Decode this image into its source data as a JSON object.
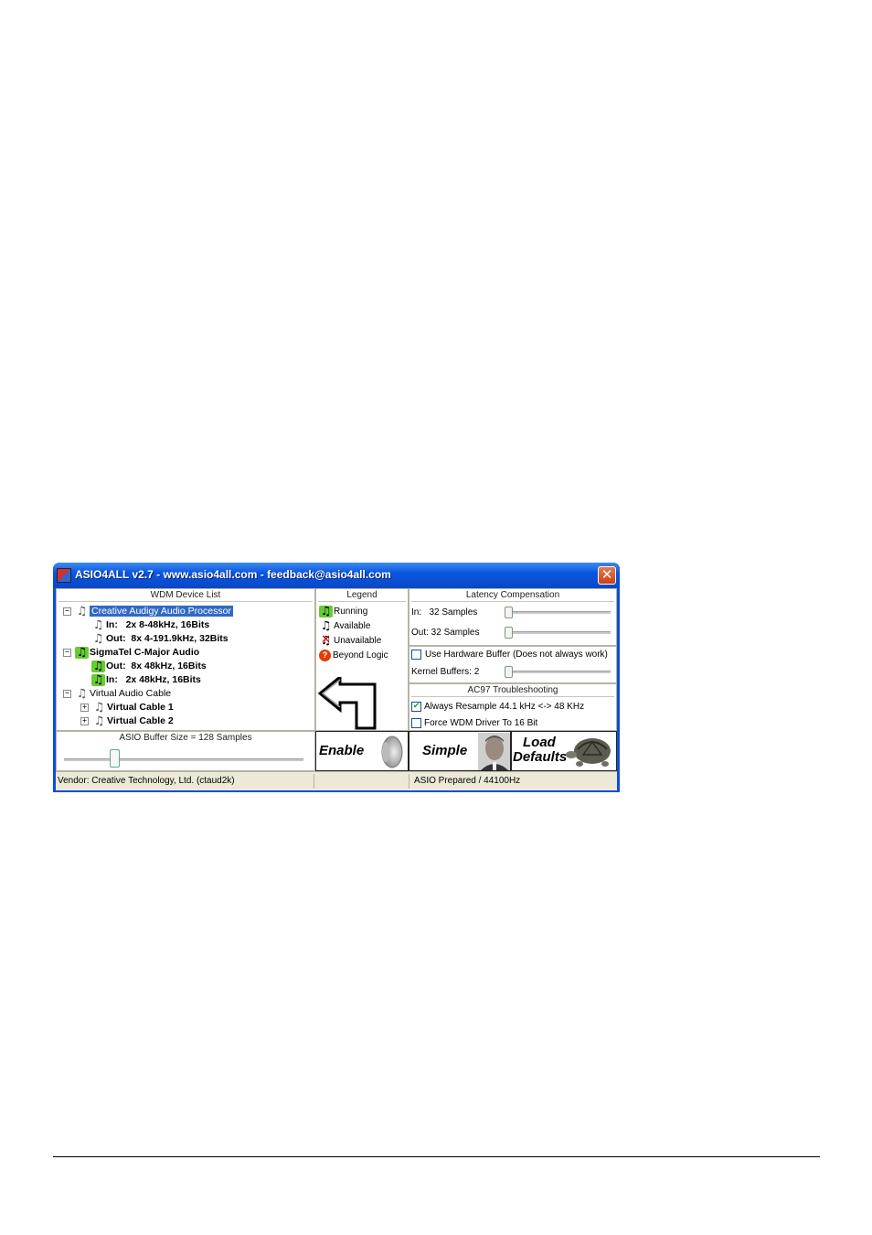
{
  "window": {
    "title": "ASIO4ALL v2.7 - www.asio4all.com - feedback@asio4all.com",
    "close_glyph": "✕"
  },
  "device_list": {
    "title": "WDM Device List",
    "items": [
      {
        "label": "Creative Audigy Audio Processor",
        "expander": "−",
        "icon": "note-available",
        "selected": true
      },
      {
        "label": "In:   2x 8-48kHz, 16Bits",
        "icon": "note-available"
      },
      {
        "label": "Out:  8x 4-191.9kHz, 32Bits",
        "icon": "note-available"
      },
      {
        "label": "SigmaTel C-Major Audio",
        "expander": "−",
        "icon": "note-running"
      },
      {
        "label": "Out:  8x 48kHz, 16Bits",
        "icon": "note-running"
      },
      {
        "label": "In:   2x 48kHz, 16Bits",
        "icon": "note-running"
      },
      {
        "label": "Virtual Audio Cable",
        "expander": "−",
        "icon": "note-available"
      },
      {
        "label": "Virtual Cable 1",
        "expander": "+",
        "icon": "note-available"
      },
      {
        "label": "Virtual Cable 2",
        "expander": "+",
        "icon": "note-available"
      }
    ]
  },
  "legend": {
    "title": "Legend",
    "items": [
      {
        "label": "Running",
        "icon": "note-running"
      },
      {
        "label": "Available",
        "icon": "note-available"
      },
      {
        "label": "Unavailable",
        "icon": "note-unavailable"
      },
      {
        "label": "Beyond Logic",
        "icon": "question-icon",
        "glyph": "?"
      }
    ]
  },
  "latency": {
    "title": "Latency Compensation",
    "in_label": "In:   32 Samples",
    "out_label": "Out: 32 Samples",
    "use_hw_buffer": "Use Hardware Buffer (Does not always work)",
    "use_hw_buffer_checked": false,
    "kernel_buffers": "Kernel Buffers: 2"
  },
  "ac97": {
    "title": "AC97 Troubleshooting",
    "resample": "Always Resample 44.1 kHz <-> 48 KHz",
    "resample_checked": true,
    "force16": "Force WDM Driver To 16 Bit",
    "force16_checked": false
  },
  "buffer": {
    "label": "ASIO Buffer Size = 128 Samples"
  },
  "buttons": {
    "enable": "Enable",
    "simple": "Simple",
    "load_line1": "Load",
    "load_line2": "Defaults"
  },
  "status": {
    "vendor": "Vendor: Creative Technology, Ltd. (ctaud2k)",
    "middle": "",
    "asio": "ASIO  Prepared / 44100Hz"
  },
  "icons": {
    "note": "♫",
    "check": "✔"
  }
}
